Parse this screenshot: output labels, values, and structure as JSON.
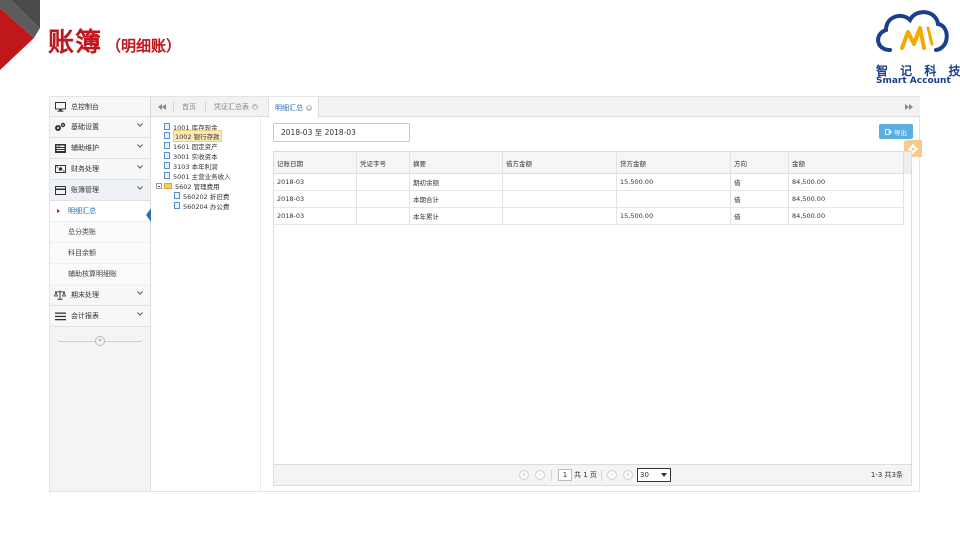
{
  "slide": {
    "title": "账簿",
    "subtitle": "（明细账）",
    "logo_cn": "智 记 科 技",
    "logo_en": "Smart  Account",
    "colors": {
      "accent": "#c0171d",
      "brand": "#1c3f8c",
      "link": "#2a6fb5",
      "export": "#5aaee0"
    }
  },
  "sidebar": {
    "items": [
      {
        "label": "总控制台",
        "icon": "monitor-icon"
      },
      {
        "label": "基础设置",
        "icon": "gears-icon"
      },
      {
        "label": "辅助维护",
        "icon": "keyboard-icon"
      },
      {
        "label": "财务处理",
        "icon": "cash-icon"
      },
      {
        "label": "账簿管理",
        "icon": "card-icon",
        "open": true
      },
      {
        "label": "期末处理",
        "icon": "scale-icon"
      },
      {
        "label": "会计报表",
        "icon": "list-icon"
      }
    ],
    "sub_items": [
      {
        "label": "明细汇总",
        "active": true
      },
      {
        "label": "总分类账"
      },
      {
        "label": "科目余额"
      },
      {
        "label": "辅助核算明细账"
      }
    ],
    "toggle_glyph": "«"
  },
  "tabs": {
    "left_nav_glyph": "◀◀",
    "right_nav_glyph": "▶▶",
    "items": [
      {
        "label": "首页",
        "closable": false
      },
      {
        "label": "凭证汇总表",
        "closable": true
      },
      {
        "label": "明细汇总",
        "closable": true,
        "active": true
      }
    ]
  },
  "tree": {
    "nodes": [
      {
        "label": "1001 库存现金",
        "type": "file",
        "level": 0
      },
      {
        "label": "1002 银行存款",
        "type": "file",
        "level": 0,
        "selected": true
      },
      {
        "label": "1601 固定资产",
        "type": "file",
        "level": 0
      },
      {
        "label": "3001 实收资本",
        "type": "file",
        "level": 0
      },
      {
        "label": "3103 本年利润",
        "type": "file",
        "level": 0
      },
      {
        "label": "5001 主营业务收入",
        "type": "file",
        "level": 0
      },
      {
        "label": "5602 管理费用",
        "type": "folder",
        "level": 0
      },
      {
        "label": "560202 折旧费",
        "type": "file",
        "level": 1
      },
      {
        "label": "560204 办公费",
        "type": "file",
        "level": 1
      }
    ]
  },
  "content": {
    "date_range": "2018-03 至 2018-03",
    "export_label": "导出",
    "table": {
      "headers": [
        "记账日期",
        "凭证字号",
        "摘要",
        "借方金额",
        "贷方金额",
        "方向",
        "金额"
      ],
      "rows": [
        [
          "2018-03",
          "",
          "期初余额",
          "",
          "15,500.00",
          "借",
          "84,500.00"
        ],
        [
          "2018-03",
          "",
          "本期合计",
          "",
          "",
          "借",
          "84,500.00"
        ],
        [
          "2018-03",
          "",
          "本年累计",
          "",
          "15,500.00",
          "借",
          "84,500.00"
        ]
      ]
    },
    "pager": {
      "first": "«",
      "prev": "‹",
      "page": "1",
      "total_text": "共 1 页",
      "next": "›",
      "last": "»",
      "page_size": "30",
      "info": "1-3 共3条"
    }
  }
}
